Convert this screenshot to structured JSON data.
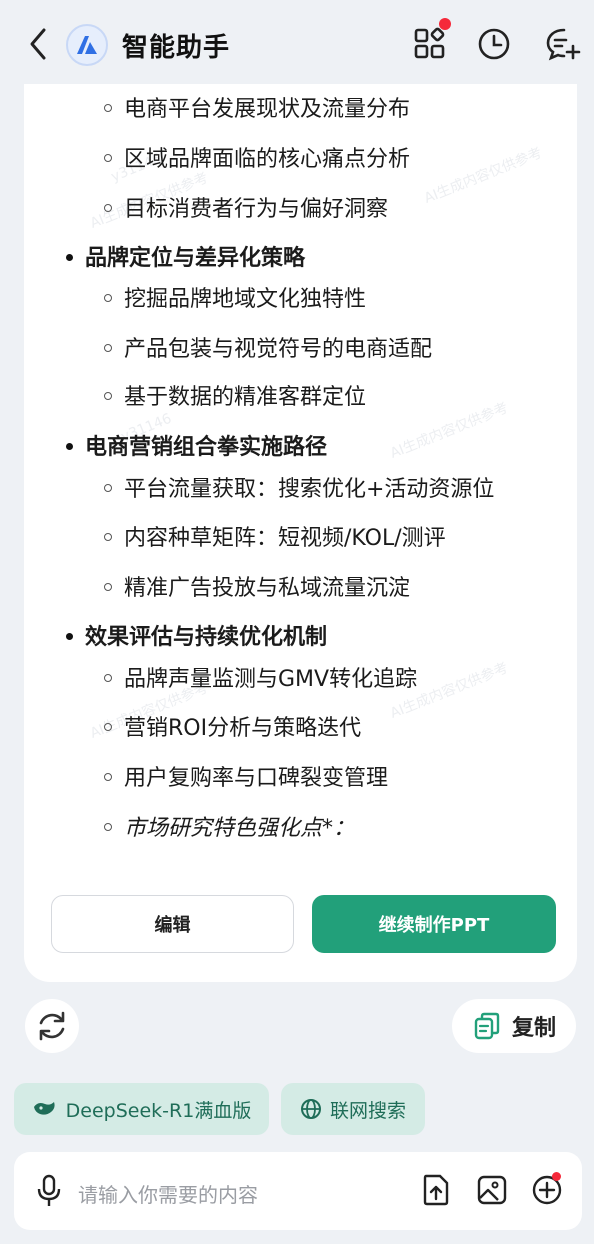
{
  "header": {
    "title": "智能助手"
  },
  "outline": {
    "items": [
      {
        "type": "sub",
        "text": "电商平台发展现状及流量分布"
      },
      {
        "type": "sub",
        "text": "区域品牌面临的核心痛点分析"
      },
      {
        "type": "sub",
        "text": "目标消费者行为与偏好洞察"
      },
      {
        "type": "main",
        "text": "品牌定位与差异化策略"
      },
      {
        "type": "sub",
        "text": "挖掘品牌地域文化独特性"
      },
      {
        "type": "sub",
        "text": "产品包装与视觉符号的电商适配"
      },
      {
        "type": "sub",
        "text": "基于数据的精准客群定位"
      },
      {
        "type": "main",
        "text": "电商营销组合拳实施路径"
      },
      {
        "type": "sub",
        "text": "平台流量获取：搜索优化+活动资源位"
      },
      {
        "type": "sub",
        "text": "内容种草矩阵：短视频/KOL/测评"
      },
      {
        "type": "sub",
        "text": "精准广告投放与私域流量沉淀"
      },
      {
        "type": "main",
        "text": "效果评估与持续优化机制"
      },
      {
        "type": "sub",
        "text": "品牌声量监测与GMV转化追踪"
      },
      {
        "type": "sub",
        "text": "营销ROI分析与策略迭代"
      },
      {
        "type": "sub",
        "text": "用户复购率与口碑裂变管理"
      },
      {
        "type": "sub-italic",
        "text": "市场研究特色强化点*："
      }
    ]
  },
  "buttons": {
    "edit": "编辑",
    "continue_ppt": "继续制作PPT",
    "copy": "复制"
  },
  "chips": {
    "model": "DeepSeek-R1满血版",
    "web_search": "联网搜索"
  },
  "input": {
    "placeholder": "请输入你需要的内容"
  },
  "watermark": {
    "id": "y31146",
    "text": "AI生成内容仅供参考"
  },
  "colors": {
    "accent": "#22a07a",
    "chip_bg": "#d4ebe5",
    "badge": "#f5293a"
  }
}
